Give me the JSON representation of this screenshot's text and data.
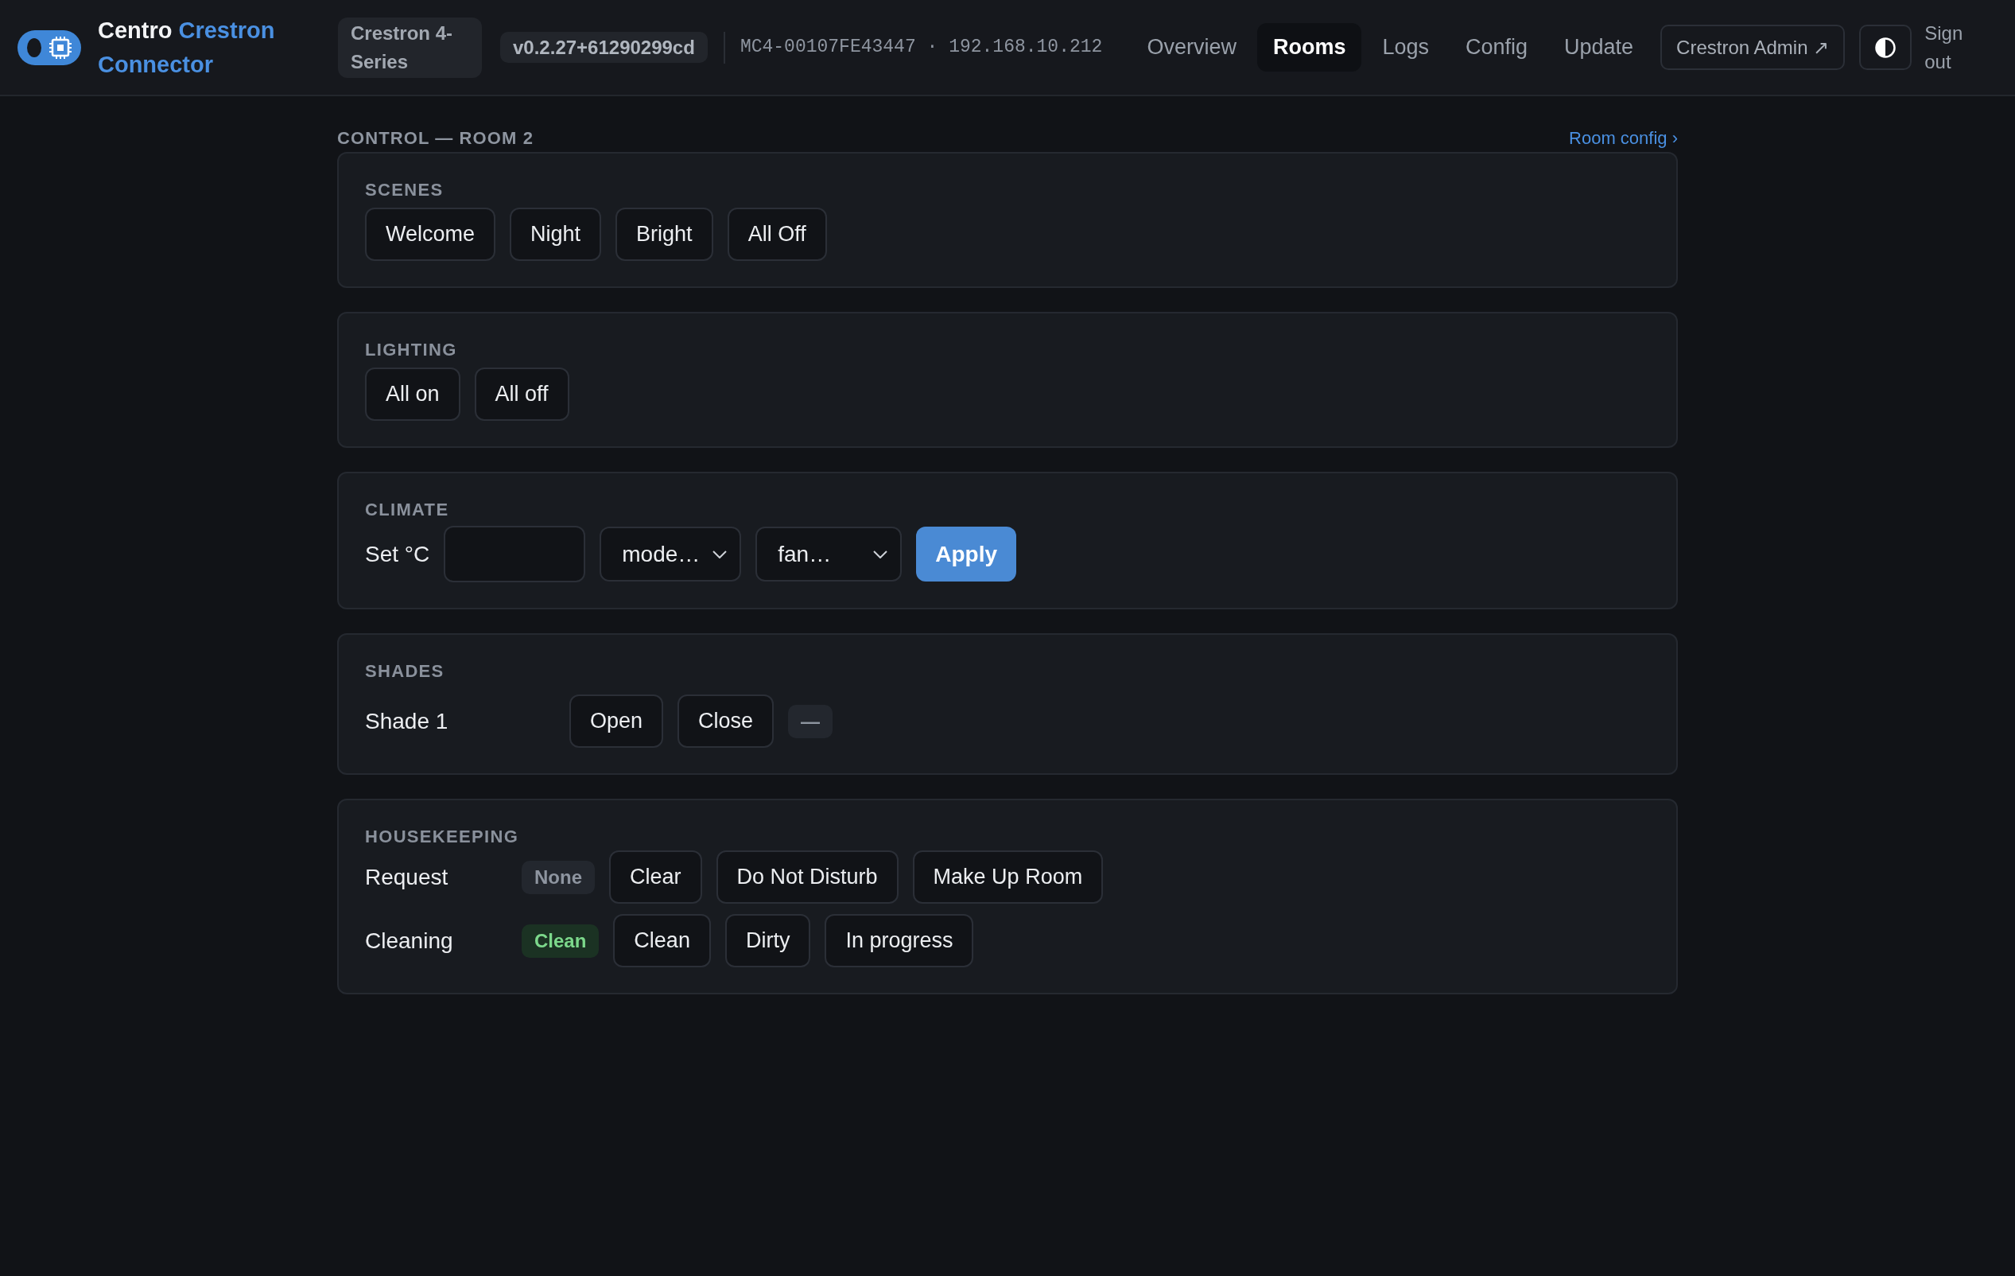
{
  "header": {
    "brand": {
      "name": "Centro",
      "product": "Crestron Connector"
    },
    "platform": "Crestron 4-Series",
    "version": "v0.2.27+61290299cd",
    "device": "MC4-00107FE43447 · 192.168.10.212",
    "nav": [
      {
        "label": "Overview",
        "selected": false
      },
      {
        "label": "Rooms",
        "selected": true
      },
      {
        "label": "Logs",
        "selected": false
      },
      {
        "label": "Config",
        "selected": false
      },
      {
        "label": "Update",
        "selected": false
      }
    ],
    "admin_link": "Crestron Admin ↗",
    "sign_out": "Sign out"
  },
  "page": {
    "title": "CONTROL — ROOM 2",
    "link": "Room config ›"
  },
  "sections": [
    {
      "kind": "buttons",
      "title": "SCENES",
      "buttons": [
        "Welcome",
        "Night",
        "Bright",
        "All Off"
      ]
    },
    {
      "kind": "buttons",
      "title": "LIGHTING",
      "buttons": [
        "All on",
        "All off"
      ]
    },
    {
      "kind": "climate",
      "title": "CLIMATE",
      "label": "Set °C",
      "selects": [
        {
          "value": "mode…"
        },
        {
          "value": "fan…"
        }
      ],
      "action": "Apply"
    },
    {
      "kind": "shades",
      "title": "SHADES",
      "rows": [
        {
          "label": "Shade 1",
          "buttons": [
            "Open",
            "Close"
          ],
          "status": {
            "text": "—",
            "kind": "neutral"
          }
        }
      ]
    },
    {
      "kind": "housekeeping",
      "title": "HOUSEKEEPING",
      "rows": [
        {
          "label": "Request",
          "status": {
            "text": "None",
            "kind": "neutral"
          },
          "buttons": [
            "Clear",
            "Do Not Disturb",
            "Make Up Room"
          ]
        },
        {
          "label": "Cleaning",
          "status": {
            "text": "Clean",
            "kind": "success"
          },
          "buttons": [
            "Clean",
            "Dirty",
            "In progress"
          ]
        }
      ]
    }
  ]
}
